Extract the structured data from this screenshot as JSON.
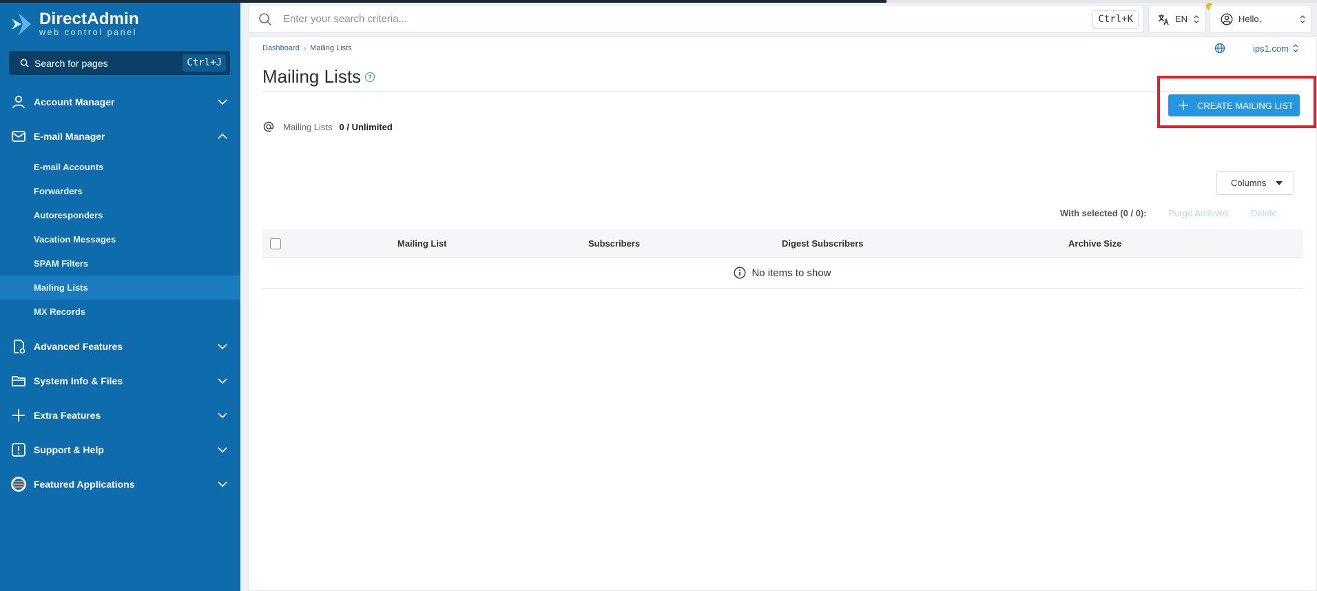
{
  "brand": {
    "title": "DirectAdmin",
    "subtitle": "web control panel"
  },
  "sidebar": {
    "search_label": "Search for pages",
    "search_shortcut": "Ctrl+J",
    "items": [
      {
        "label": "Account Manager",
        "icon": "user-icon",
        "expanded": false
      },
      {
        "label": "E-mail Manager",
        "icon": "envelope-icon",
        "expanded": true,
        "children": [
          "E-mail Accounts",
          "Forwarders",
          "Autoresponders",
          "Vacation Messages",
          "SPAM Filters",
          "Mailing Lists",
          "MX Records"
        ],
        "active_child": "Mailing Lists"
      },
      {
        "label": "Advanced Features",
        "icon": "advanced-settings-icon",
        "expanded": false
      },
      {
        "label": "System Info & Files",
        "icon": "folder-icon",
        "expanded": false
      },
      {
        "label": "Extra Features",
        "icon": "plus-icon",
        "expanded": false
      },
      {
        "label": "Support & Help",
        "icon": "alert-icon",
        "expanded": false
      },
      {
        "label": "Featured Applications",
        "icon": "apps-globe-icon",
        "expanded": false
      }
    ]
  },
  "topbar": {
    "search_placeholder": "Enter your search criteria...",
    "search_shortcut": "Ctrl+K",
    "language": "EN",
    "user_greeting": "Hello,"
  },
  "breadcrumb": {
    "home": "Dashboard",
    "current": "Mailing Lists"
  },
  "domain_selector": "ips1.com",
  "page": {
    "title": "Mailing Lists",
    "create_button": "CREATE MAILING LIST",
    "stat_label": "Mailing Lists",
    "stat_value": "0 / Unlimited",
    "columns_button": "Columns",
    "with_selected": "With selected (0 / 0):",
    "action_purge": "Purge Archives",
    "action_delete": "Delete",
    "table": {
      "headers": [
        "Mailing List",
        "Subscribers",
        "Digest Subscribers",
        "Archive Size"
      ],
      "empty_message": "No items to show"
    }
  },
  "colors": {
    "sidebar_bg": "#0e6cad",
    "accent": "#2596e2",
    "highlight": "#e41f2a"
  }
}
